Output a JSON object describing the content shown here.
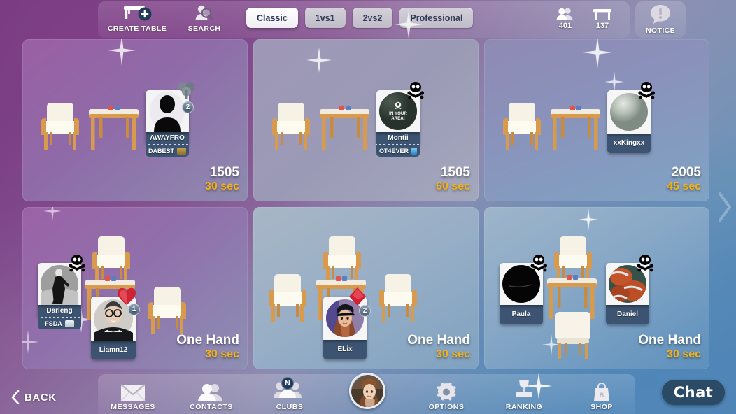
{
  "topbar": {
    "create_table_label": "CREATE TABLE",
    "search_label": "SEARCH",
    "filters": [
      {
        "label": "Classic",
        "active": true
      },
      {
        "label": "1vs1",
        "active": false
      },
      {
        "label": "2vs2",
        "active": false
      },
      {
        "label": "Professional",
        "active": false
      }
    ],
    "counters": [
      {
        "icon": "players-icon",
        "value": "401"
      },
      {
        "icon": "tables-icon",
        "value": "137"
      }
    ],
    "notice_label": "NOTICE"
  },
  "tables": [
    {
      "id": "table-1",
      "stake": "1505",
      "time": "30 sec",
      "theme": "purple",
      "players": [
        {
          "name": "AWAYFRO",
          "club": "DABEST",
          "avatar": "silhouette-avatar",
          "badge_num": "2",
          "badge_icon": "club-suit-badge",
          "skull": false
        }
      ]
    },
    {
      "id": "table-2",
      "stake": "1505",
      "time": "60 sec",
      "theme": "lavender",
      "players": [
        {
          "name": "Montii",
          "club": "OT4EVER",
          "avatar": "in-your-area-avatar",
          "avatar_text": "IN YOUR AREA!",
          "badge_num": null,
          "badge_icon": null,
          "skull": true
        }
      ]
    },
    {
      "id": "table-3",
      "stake": "2005",
      "time": "45 sec",
      "theme": "blue-violet",
      "players": [
        {
          "name": "xxKingxx",
          "club": null,
          "avatar": "sphere-avatar",
          "badge_num": null,
          "badge_icon": null,
          "skull": true
        }
      ]
    },
    {
      "id": "table-4",
      "stake": "One Hand",
      "time": "30 sec",
      "theme": "purple",
      "players": [
        {
          "name": "Darleng",
          "club": "FSDA",
          "avatar": "dancer-avatar",
          "badge_num": null,
          "badge_icon": null,
          "skull": true
        },
        {
          "name": "Liamn12",
          "club": null,
          "avatar": "man-glasses-avatar",
          "badge_num": "1",
          "badge_icon": "heart-suit-badge",
          "skull": false
        }
      ]
    },
    {
      "id": "table-5",
      "stake": "One Hand",
      "time": "30 sec",
      "theme": "blue",
      "players": [
        {
          "name": "ELix",
          "club": null,
          "avatar": "woman-cap-avatar",
          "badge_num": "2",
          "badge_icon": "diamond-suit-badge",
          "skull": false
        }
      ]
    },
    {
      "id": "table-6",
      "stake": "One Hand",
      "time": "30 sec",
      "theme": "blue",
      "players": [
        {
          "name": "Paula",
          "club": null,
          "avatar": "dark-circle-avatar",
          "badge_num": null,
          "badge_icon": null,
          "skull": true
        },
        {
          "name": "Daniel",
          "club": null,
          "avatar": "basketball-avatar",
          "badge_num": null,
          "badge_icon": null,
          "skull": true
        }
      ]
    }
  ],
  "bottombar": {
    "back_label": "BACK",
    "nav": [
      {
        "label": "MESSAGES",
        "icon": "envelope-icon",
        "badge": null
      },
      {
        "label": "CONTACTS",
        "icon": "contacts-icon",
        "badge": null
      },
      {
        "label": "CLUBS",
        "icon": "clubs-icon",
        "badge": "N"
      },
      {
        "label": "OPTIONS",
        "icon": "gear-icon",
        "badge": null
      },
      {
        "label": "RANKING",
        "icon": "trophy-icon",
        "badge": null
      },
      {
        "label": "SHOP",
        "icon": "shopping-bag-icon",
        "badge": null
      }
    ],
    "avatar_name": "user-avatar",
    "chat_label": "Chat"
  },
  "colors": {
    "accent_time": "#f2b119",
    "card_name_bg": "#3c5472",
    "chat_bg": "#2b4a66"
  }
}
